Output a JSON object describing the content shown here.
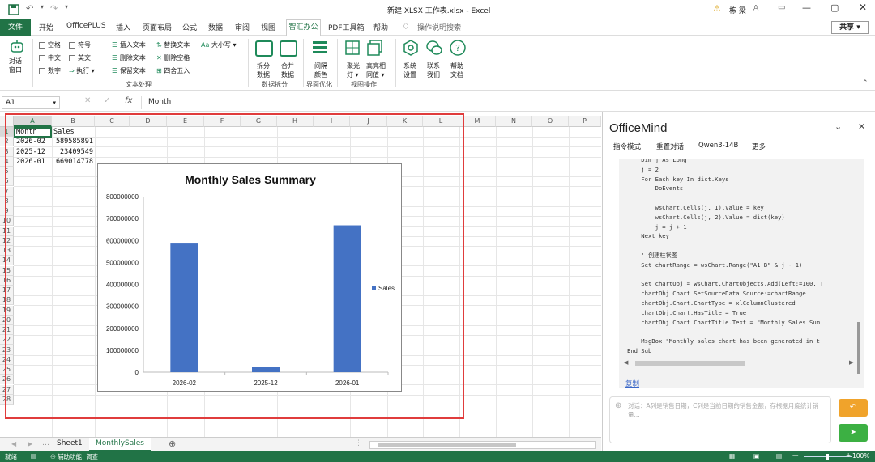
{
  "titlebar": {
    "filename": "新建 XLSX 工作表.xlsx",
    "sep": "-",
    "app": "Excel",
    "user": "栋 梁"
  },
  "tabs": [
    "开始",
    "OfficePLUS",
    "插入",
    "页面布局",
    "公式",
    "数据",
    "审阅",
    "视图",
    "智汇办公",
    "PDF工具箱",
    "帮助"
  ],
  "file_tab": "文件",
  "active_tab": "智汇办公",
  "search_hint": "操作说明搜索",
  "share_label": "共享",
  "ribbon": {
    "dialog_btn": [
      "对话",
      "窗口"
    ],
    "checks": [
      "空格",
      "符号",
      "中文",
      "英文",
      "数字"
    ],
    "exec": "执行",
    "text_ops": [
      "插入文本",
      "替换文本",
      "大小写",
      "删除文本",
      "删除空格",
      "保留文本",
      "四舍五入"
    ],
    "group_text": "文本处理",
    "split": [
      "拆分",
      "数据"
    ],
    "merge": [
      "合并",
      "数据"
    ],
    "group_split": "数据拆分",
    "interval": [
      "间隔",
      "颜色"
    ],
    "group_ui": "界面优化",
    "spotlight": [
      "聚光",
      "灯"
    ],
    "highlight": [
      "高亮相",
      "同值"
    ],
    "group_view": "视图操作",
    "settings": [
      "系统",
      "设置"
    ],
    "contact": [
      "联系",
      "我们"
    ],
    "help": [
      "帮助",
      "文档"
    ]
  },
  "formula": {
    "namebox": "A1",
    "fx": "fx",
    "content": "Month"
  },
  "columns": [
    "A",
    "B",
    "C",
    "D",
    "E",
    "F",
    "G",
    "H",
    "I",
    "J",
    "K",
    "L",
    "M",
    "N",
    "O",
    "P"
  ],
  "rows": [
    "1",
    "2",
    "3",
    "4",
    "5",
    "6",
    "7",
    "8",
    "9",
    "10",
    "11",
    "12",
    "13",
    "14",
    "15",
    "16",
    "17",
    "18",
    "19",
    "20",
    "21",
    "22",
    "23",
    "24",
    "25",
    "26",
    "27",
    "28"
  ],
  "cells": [
    [
      "Month",
      "Sales"
    ],
    [
      "2026-02",
      "589585891"
    ],
    [
      "2025-12",
      "23409549"
    ],
    [
      "2026-01",
      "669014778"
    ]
  ],
  "chart_data": {
    "type": "bar",
    "title": "Monthly Sales Summary",
    "categories": [
      "2026-02",
      "2025-12",
      "2026-01"
    ],
    "series": [
      {
        "name": "Sales",
        "values": [
          589585891,
          23409549,
          669014778
        ],
        "color": "#4472c4"
      }
    ],
    "ylim": [
      0,
      800000000
    ],
    "yticks": [
      "800000000",
      "700000000",
      "600000000",
      "500000000",
      "400000000",
      "300000000",
      "200000000",
      "100000000",
      "0"
    ],
    "grid": false,
    "legend": "right"
  },
  "sheets": [
    "Sheet1",
    "MonthlySales"
  ],
  "active_sheet": "MonthlySales",
  "status": {
    "ready": "就绪",
    "accessibility": "辅助功能: 调查",
    "zoom": "100%"
  },
  "panel": {
    "title": "OfficeMind",
    "menu": [
      "指令模式",
      "重置对话",
      "Qwen3-14B",
      "更多"
    ],
    "code_lines": [
      "    Dim j As Long",
      "    j = 2",
      "    For Each key In dict.Keys",
      "        DoEvents",
      "",
      "        wsChart.Cells(j, 1).Value = key",
      "        wsChart.Cells(j, 2).Value = dict(key)",
      "        j = j + 1",
      "    Next key",
      "",
      "    ' 创建柱状图",
      "    Set chartRange = wsChart.Range(\"A1:B\" & j - 1)",
      "",
      "    Set chartObj = wsChart.ChartObjects.Add(Left:=100, T",
      "    chartObj.Chart.SetSourceData Source:=chartRange",
      "    chartObj.Chart.ChartType = xlColumnClustered",
      "    chartObj.Chart.HasTitle = True",
      "    chartObj.Chart.ChartTitle.Text = \"Monthly Sales Sum",
      "",
      "    MsgBox \"Monthly sales chart has been generated in t",
      "End Sub"
    ],
    "copy": "复制",
    "input_placeholder": "对话：A列是销售日期，C列是当前日期的销售金额，存根据月度统计销量...",
    "colors": {
      "accent": "#217346",
      "send": "#3cb043",
      "stop": "#f0a32b"
    }
  }
}
